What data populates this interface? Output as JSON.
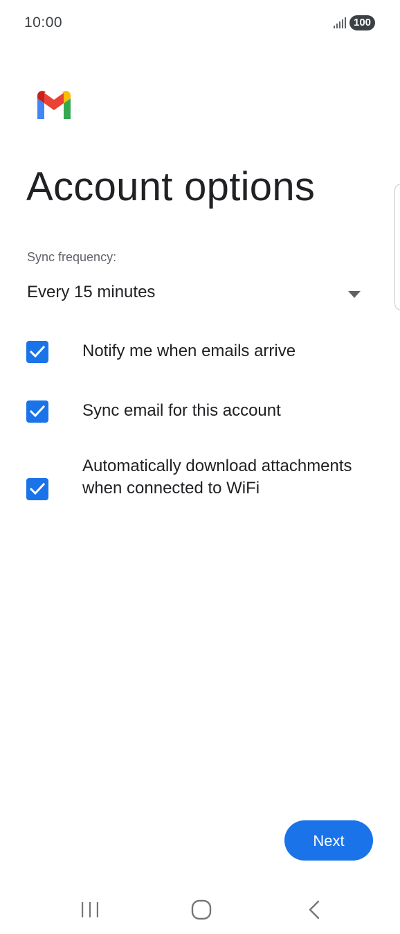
{
  "status_bar": {
    "time": "10:00",
    "battery": "100"
  },
  "header": {
    "logo_icon": "gmail-logo-icon",
    "title": "Account options"
  },
  "sync": {
    "label": "Sync frequency:",
    "selected_value": "Every 15 minutes"
  },
  "options": [
    {
      "label": "Notify me when emails arrive",
      "checked": true
    },
    {
      "label": "Sync email for this account",
      "checked": true
    },
    {
      "label": "Automatically download attachments when connected to WiFi",
      "checked": true
    }
  ],
  "footer": {
    "next_label": "Next"
  },
  "colors": {
    "accent": "#1a73e8",
    "text_primary": "#202124",
    "text_secondary": "#5f6368"
  },
  "nav_bar": {
    "icons": [
      "recents-icon",
      "home-icon",
      "back-icon"
    ]
  }
}
